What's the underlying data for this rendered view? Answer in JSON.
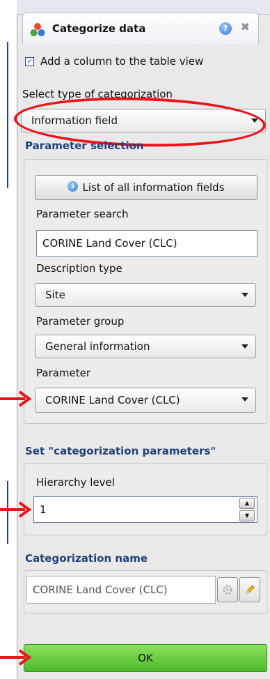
{
  "panel": {
    "title": "Categorize data",
    "help_icon_glyph": "?",
    "close_icon_glyph": "✖"
  },
  "add_column": {
    "checked": true,
    "label": "Add a column to the table view"
  },
  "categorization_type": {
    "label": "Select type of categorization",
    "value": "Information field"
  },
  "parameter_selection": {
    "header": "Parameter selection",
    "list_button": "List of all information fields",
    "search_label": "Parameter search",
    "search_value": "CORINE Land Cover (CLC)",
    "description_type_label": "Description type",
    "description_type_value": "Site",
    "parameter_group_label": "Parameter group",
    "parameter_group_value": "General information",
    "parameter_label": "Parameter",
    "parameter_value": "CORINE Land Cover (CLC)"
  },
  "categorization_parameters": {
    "header": "Set \"categorization parameters\"",
    "hierarchy_label": "Hierarchy level",
    "hierarchy_value": "1"
  },
  "categorization_name": {
    "header": "Categorization name",
    "value": "CORINE Land Cover (CLC)"
  },
  "ok_button": "OK",
  "colors": {
    "annotation_red": "#e8141a",
    "ok_green": "#5cc93a",
    "header_blue": "#23407a"
  }
}
